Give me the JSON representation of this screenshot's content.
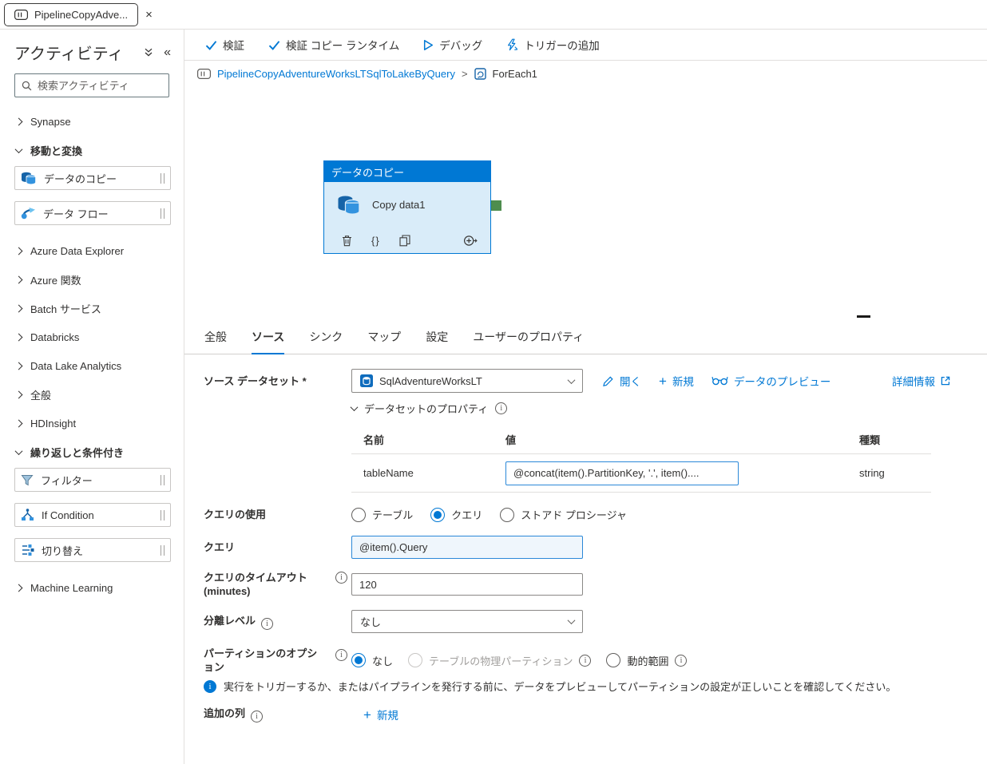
{
  "colors": {
    "accent": "#0078d4",
    "node_header": "#0078d4",
    "node_body": "#d9ecf9",
    "connector_green": "#4e8d4e"
  },
  "icons": {
    "close": "×",
    "collapse": "«",
    "plus": "+",
    "braces": "{}"
  },
  "tab_bar": {
    "tab_title": "PipelineCopyAdve..."
  },
  "sidebar": {
    "title": "アクティビティ",
    "search_placeholder": "検索アクティビティ",
    "groups": {
      "synapse": "Synapse",
      "move_transform": "移動と変換",
      "azure_data_explorer": "Azure Data Explorer",
      "azure_functions": "Azure 関数",
      "batch_service": "Batch サービス",
      "databricks": "Databricks",
      "data_lake_analytics": "Data Lake Analytics",
      "general": "全般",
      "hdinsight": "HDInsight",
      "iteration": "繰り返しと条件付き",
      "machine_learning": "Machine Learning"
    },
    "activities": {
      "copy_data": "データのコピー",
      "data_flow": "データ フロー",
      "filter": "フィルター",
      "if_condition": "If Condition",
      "switch": "切り替え"
    }
  },
  "toolbar": {
    "validate": "検証",
    "validate_copy_runtime": "検証 コピー ランタイム",
    "debug": "デバッグ",
    "add_trigger": "トリガーの追加"
  },
  "breadcrumb": {
    "pipeline": "PipelineCopyAdventureWorksLTSqlToLakeByQuery",
    "separator": ">",
    "activity": "ForEach1"
  },
  "canvas": {
    "node_header": "データのコピー",
    "node_name": "Copy data1"
  },
  "properties": {
    "tabs": [
      "全般",
      "ソース",
      "シンク",
      "マップ",
      "設定",
      "ユーザーのプロパティ"
    ],
    "active_tab": "ソース",
    "source_dataset_label": "ソース データセット *",
    "source_dataset_value": "SqlAdventureWorksLT",
    "open_label": "開く",
    "new_label": "新規",
    "preview_label": "データのプレビュー",
    "learn_more_label": "詳細情報",
    "dataset_properties_label": "データセットのプロパティ",
    "table": {
      "headers": [
        "名前",
        "値",
        "種類"
      ],
      "row": {
        "name": "tableName",
        "value": "@concat(item().PartitionKey, '.', item()....",
        "type": "string"
      }
    },
    "use_query_label": "クエリの使用",
    "use_query_options": [
      "テーブル",
      "クエリ",
      "ストアド プロシージャ"
    ],
    "use_query_selected": "クエリ",
    "query_label": "クエリ",
    "query_value": "@item().Query",
    "query_timeout_label": "クエリのタイムアウト",
    "query_timeout_sublabel": "(minutes)",
    "query_timeout_value": "120",
    "isolation_label": "分離レベル",
    "isolation_value": "なし",
    "partition_label": "パーティションのオプション",
    "partition_options": [
      "なし",
      "テーブルの物理パーティション",
      "動的範囲"
    ],
    "partition_selected": "なし",
    "info_message": "実行をトリガーするか、またはパイプラインを発行する前に、データをプレビューしてパーティションの設定が正しいことを確認してください。",
    "additional_columns_label": "追加の列",
    "additional_new_label": "新規"
  }
}
